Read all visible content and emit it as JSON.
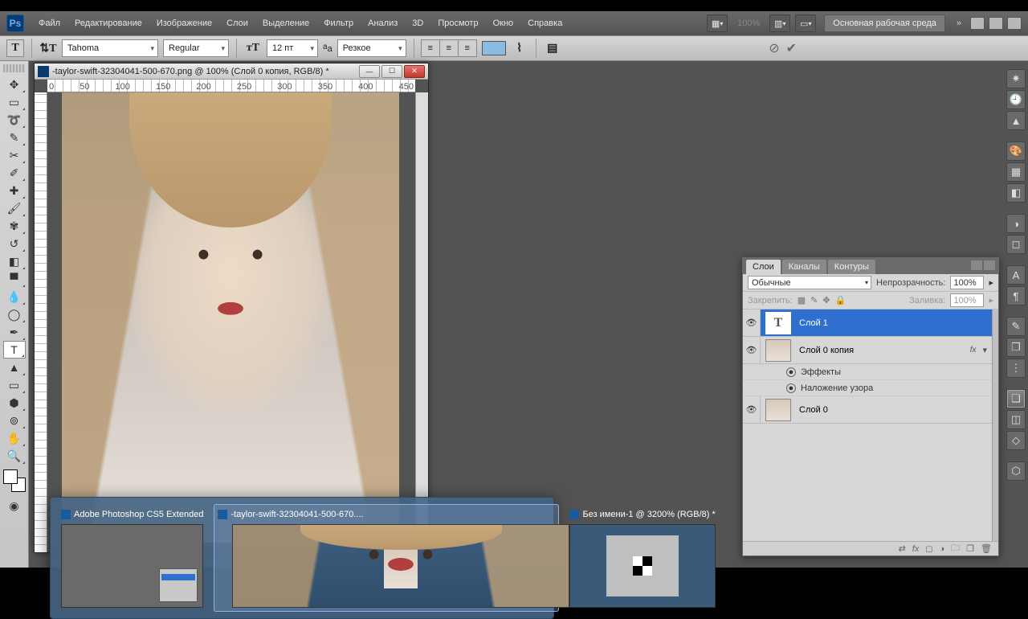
{
  "app": {
    "logo": "Ps"
  },
  "menu": [
    "Файл",
    "Редактирование",
    "Изображение",
    "Слои",
    "Выделение",
    "Фильтр",
    "Анализ",
    "3D",
    "Просмотр",
    "Окно",
    "Справка"
  ],
  "menu_right": {
    "zoom": "100%",
    "workspace": "Основная рабочая среда"
  },
  "options": {
    "font_family": "Tahoma",
    "font_style": "Regular",
    "font_size": "12 пт",
    "aa": "Резкое",
    "color": "#8bbbe0"
  },
  "document": {
    "title": "-taylor-swift-32304041-500-670.png @ 100% (Слой 0 копия, RGB/8) *",
    "ruler_marks": [
      "0",
      "50",
      "100",
      "150",
      "200",
      "250",
      "300",
      "350",
      "400",
      "450"
    ]
  },
  "layers_panel": {
    "tabs": [
      "Слои",
      "Каналы",
      "Контуры"
    ],
    "blend": "Обычные",
    "opacity_label": "Непрозрачность:",
    "opacity": "100%",
    "lock_label": "Закрепить:",
    "fill_label": "Заливка:",
    "fill": "100%",
    "items": [
      {
        "name": "Слой 1",
        "thumb": "T",
        "selected": true
      },
      {
        "name": "Слой 0 копия",
        "thumb": "img",
        "fx": "fx",
        "effects": [
          "Эффекты",
          "Наложение узора"
        ]
      },
      {
        "name": "Слой 0",
        "thumb": "img"
      }
    ]
  },
  "taskbar": [
    {
      "title": "Adobe Photoshop CS5 Extended",
      "kind": "ps"
    },
    {
      "title": "-taylor-swift-32304041-500-670....",
      "kind": "img",
      "active": true
    },
    {
      "title": "Без имени-1 @ 3200% (RGB/8) *",
      "kind": "pat"
    }
  ]
}
